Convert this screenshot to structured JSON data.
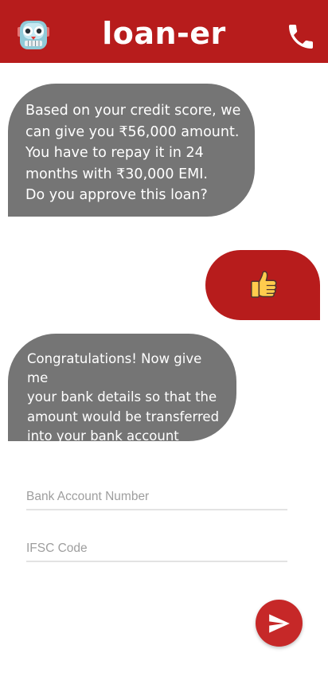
{
  "header": {
    "title": "loan-er",
    "left_icon": "robot-face-icon",
    "right_icon": "phone-icon",
    "background_color": "#b71c1c"
  },
  "messages": [
    {
      "from": "bot",
      "text": "Based on your credit score, we\ncan give you ₹56,000 amount.\nYou have to repay it in 24\nmonths  with ₹30,000 EMI.\nDo you approve this loan?",
      "color": "#757575"
    },
    {
      "from": "user",
      "icon": "thumbs-up-icon",
      "color": "#b71c1c"
    },
    {
      "from": "bot",
      "text": "Congratulations! Now give me\nyour bank details so that the\namount would be transferred\ninto your bank account",
      "color": "#757575"
    }
  ],
  "form": {
    "account_placeholder": "Bank Account Number",
    "account_value": "",
    "ifsc_placeholder": "IFSC Code",
    "ifsc_value": ""
  },
  "send_button": {
    "icon": "send-icon",
    "color": "#c62828"
  }
}
